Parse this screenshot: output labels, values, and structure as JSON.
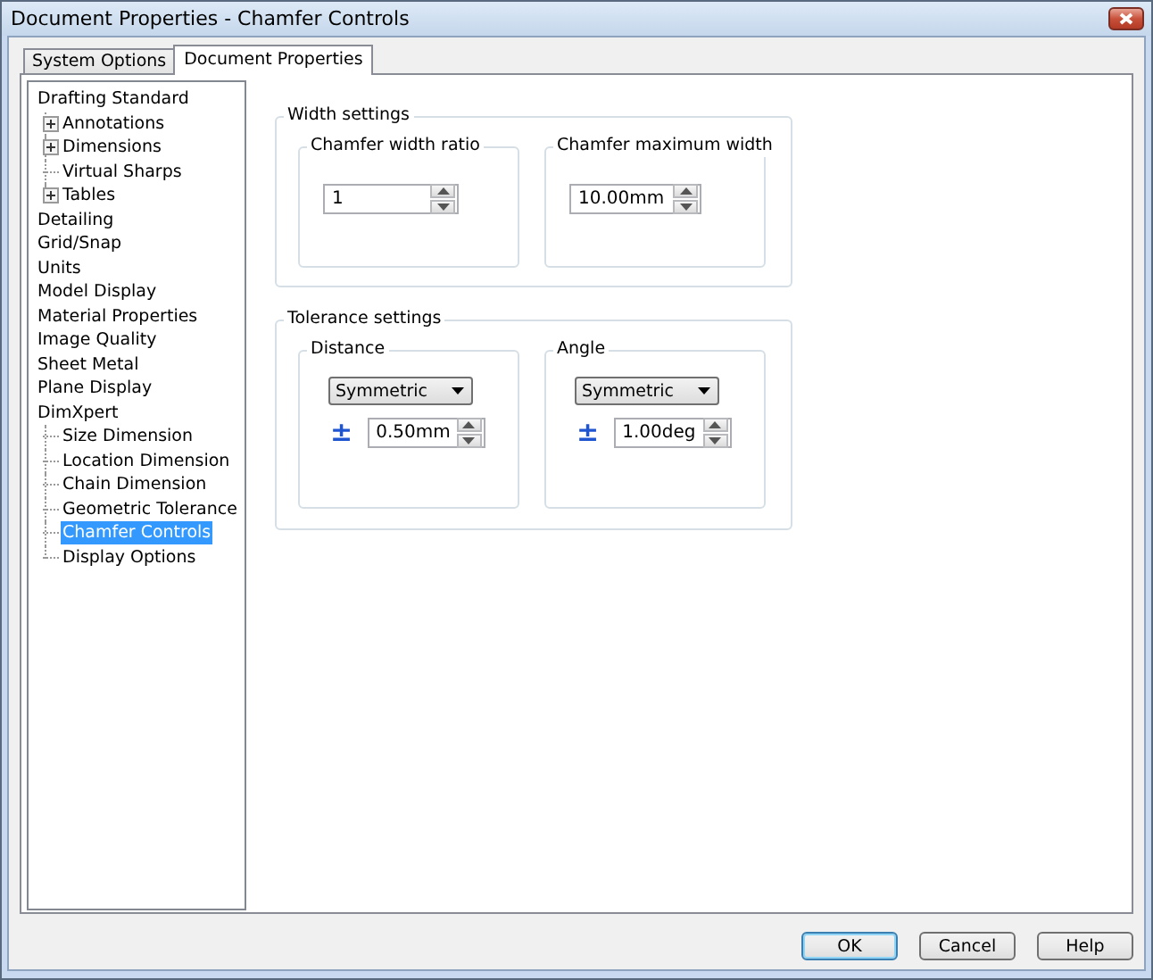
{
  "window": {
    "title": "Document Properties - Chamfer Controls"
  },
  "tabs": [
    {
      "label": "System Options",
      "selected": false
    },
    {
      "label": "Document Properties",
      "selected": true
    }
  ],
  "tree": [
    {
      "label": "Drafting Standard",
      "selected": false,
      "children": [
        {
          "label": "Annotations",
          "kind": "expandable",
          "selected": false
        },
        {
          "label": "Dimensions",
          "kind": "expandable",
          "selected": false
        },
        {
          "label": "Virtual Sharps",
          "kind": "leaf",
          "selected": false
        },
        {
          "label": "Tables",
          "kind": "expandable",
          "selected": false
        }
      ]
    },
    {
      "label": "Detailing",
      "selected": false
    },
    {
      "label": "Grid/Snap",
      "selected": false
    },
    {
      "label": "Units",
      "selected": false
    },
    {
      "label": "Model Display",
      "selected": false
    },
    {
      "label": "Material Properties",
      "selected": false
    },
    {
      "label": "Image Quality",
      "selected": false
    },
    {
      "label": "Sheet Metal",
      "selected": false
    },
    {
      "label": "Plane Display",
      "selected": false
    },
    {
      "label": "DimXpert",
      "selected": false,
      "children": [
        {
          "label": "Size Dimension",
          "kind": "leaf",
          "selected": false
        },
        {
          "label": "Location Dimension",
          "kind": "leaf",
          "selected": false
        },
        {
          "label": "Chain Dimension",
          "kind": "leaf",
          "selected": false
        },
        {
          "label": "Geometric Tolerance",
          "kind": "leaf",
          "selected": false
        },
        {
          "label": "Chamfer Controls",
          "kind": "leaf",
          "selected": true
        },
        {
          "label": "Display Options",
          "kind": "leaf",
          "selected": false
        }
      ]
    }
  ],
  "width_settings": {
    "title": "Width settings",
    "groups": [
      {
        "title": "Chamfer width ratio",
        "value": "1"
      },
      {
        "title": "Chamfer maximum width",
        "value": "10.00mm"
      }
    ]
  },
  "tolerance_settings": {
    "title": "Tolerance settings",
    "groups": [
      {
        "title": "Distance",
        "type": "Symmetric",
        "symbol": "±",
        "value": "0.50mm"
      },
      {
        "title": "Angle",
        "type": "Symmetric",
        "symbol": "±",
        "value": "1.00deg"
      }
    ]
  },
  "buttons": [
    {
      "label": "OK",
      "default": true
    },
    {
      "label": "Cancel",
      "default": false
    },
    {
      "label": "Help",
      "default": false
    }
  ]
}
